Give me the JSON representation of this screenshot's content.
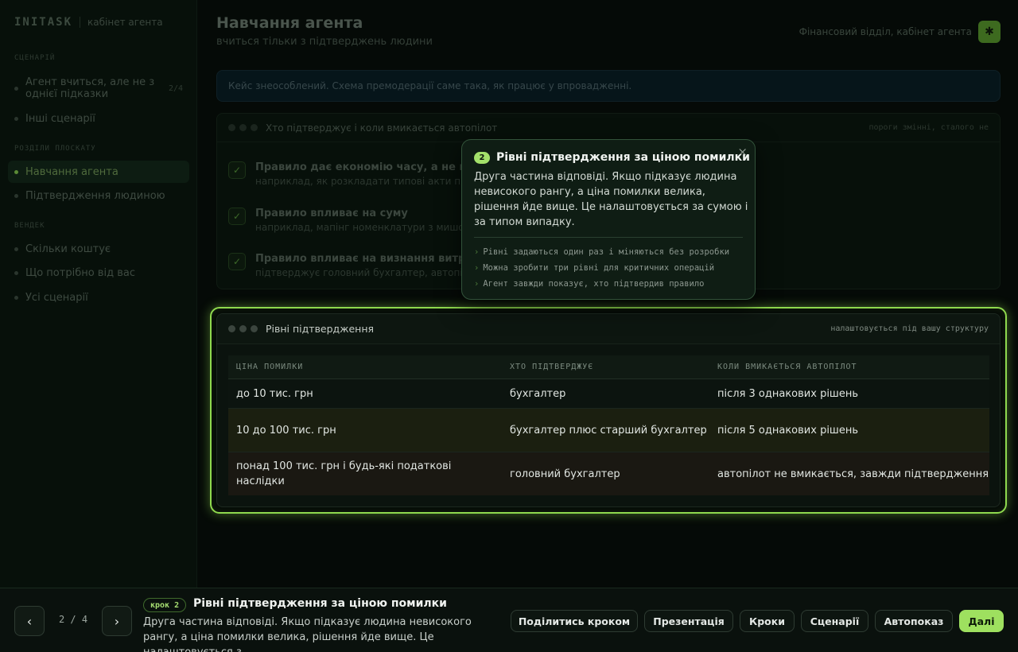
{
  "sidebar": {
    "brand": "INITASK",
    "subtitle": "кабінет агента",
    "sections": [
      {
        "title": "СЦЕНАРІЙ"
      },
      {
        "title": "РОЗДІЛИ ПЛОСКАТУ"
      },
      {
        "title": "ВЕНДЕК"
      }
    ],
    "items": [
      {
        "label": "Агент вчиться, але не з однієї підказки",
        "count": "2/4"
      },
      {
        "label": "Інші сценарії"
      },
      {
        "label": "Навчання агента"
      },
      {
        "label": "Підтвердження людиною"
      },
      {
        "label": "Скільки коштує"
      },
      {
        "label": "Що потрібно від вас"
      },
      {
        "label": "Усі сценарії"
      }
    ]
  },
  "header": {
    "title": "Навчання агента",
    "subtitle": "вчиться тільки з підтверджень людини",
    "org": "Фінансовий відділ, кабінет агента",
    "avatar_icon": "settings-icon"
  },
  "notice": "Кейс знеособлений. Схема премодерації саме така, як працює у впровадженні.",
  "rules_panel": {
    "title": "Хто підтверджує і коли вмикається автопілот",
    "hint": "пороги змінні, сталого не",
    "rules": [
      {
        "title": "Правило дає економію часу, а не г",
        "desc": "наприклад, як розкладати типові акти пр"
      },
      {
        "title": "Правило впливає на суму",
        "desc": "наприклад, мапінг номенклатури з мишо"
      },
      {
        "title": "Правило впливає на визнання витр",
        "desc": "підтверджує головний бухгалтер, автопі"
      }
    ]
  },
  "levels_panel": {
    "title": "Рівні підтвердження",
    "hint": "налаштовується під вашу структуру",
    "columns": [
      "ЦІНА ПОМИЛКИ",
      "ХТО ПІДТВЕРДЖУЄ",
      "КОЛИ ВМИКАЄТЬСЯ АВТОПІЛОТ"
    ],
    "rows": [
      {
        "cost": "до 10 тис. грн",
        "who": "бухгалтер",
        "when": "після 3 однакових рішень"
      },
      {
        "cost": "10 до 100 тис. грн",
        "who": "бухгалтер плюс старший бухгалтер",
        "when": "після 5 однакових рішень"
      },
      {
        "cost": "понад 100 тис. грн і будь-які податкові наслідки",
        "who": "головний бухгалтер",
        "when": "автопілот не вмикається, завжди підтвердження"
      }
    ]
  },
  "popover": {
    "number": "2",
    "title": "Рівні підтвердження за ціною помилки",
    "body": "Друга частина відповіді. Якщо підказує людина невисокого рангу, а ціна помилки велика, рішення йде вище. Це налаштовується за сумою і за типом випадку.",
    "bullets": [
      "Рівні задаються один раз і міняються без розробки",
      "Можна зробити три рівні для критичних операцій",
      "Агент завжди показує, хто підтвердив правило"
    ],
    "close_glyph": "×"
  },
  "bottom_bar": {
    "prev_glyph": "‹",
    "next_glyph": "›",
    "counter": "2 / 4",
    "step_badge": "крок 2",
    "step_title": "Рівні підтвердження за ціною помилки",
    "step_desc": "Друга частина відповіді. Якщо підказує людина невисокого рангу, а ціна помилки велика, рішення йде вище. Це налаштовується з…",
    "buttons": {
      "share": "Поділитись кроком",
      "presentation": "Презентація",
      "steps": "Кроки",
      "scenarios": "Сценарії",
      "autoplay": "Автопоказ",
      "next": "Далі"
    }
  },
  "colors": {
    "accent": "#9ee05f",
    "highlight_border": "#8fd94e",
    "background": "#050a07"
  }
}
